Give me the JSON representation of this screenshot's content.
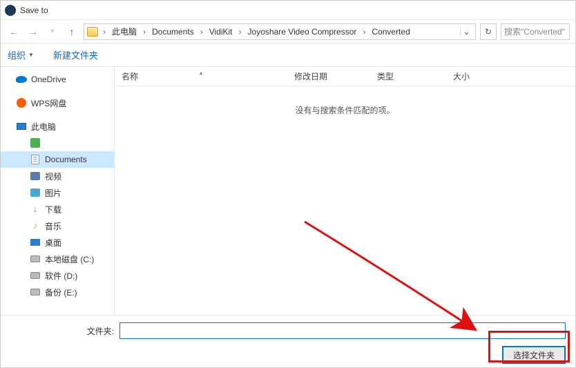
{
  "title": "Save to",
  "breadcrumb": {
    "items": [
      "此电脑",
      "Documents",
      "VidiKit",
      "Joyoshare Video Compressor",
      "Converted"
    ]
  },
  "search": {
    "placeholder": "搜索\"Converted\""
  },
  "toolbar": {
    "organize": "组织",
    "newfolder": "新建文件夹"
  },
  "sidebar": {
    "onedrive": "OneDrive",
    "wps": "WPS网盘",
    "thispc": "此电脑",
    "green": "",
    "documents": "Documents",
    "videos": "视频",
    "pictures": "图片",
    "downloads": "下载",
    "music": "音乐",
    "desktop": "桌面",
    "diskc": "本地磁盘 (C:)",
    "diskd": "软件 (D:)",
    "diske": "备份 (E:)"
  },
  "columns": {
    "name": "名称",
    "date": "修改日期",
    "type": "类型",
    "size": "大小"
  },
  "empty": "没有与搜索条件匹配的项。",
  "bottom": {
    "folder_label": "文件夹:",
    "folder_value": "",
    "select_btn": "选择文件夹"
  }
}
